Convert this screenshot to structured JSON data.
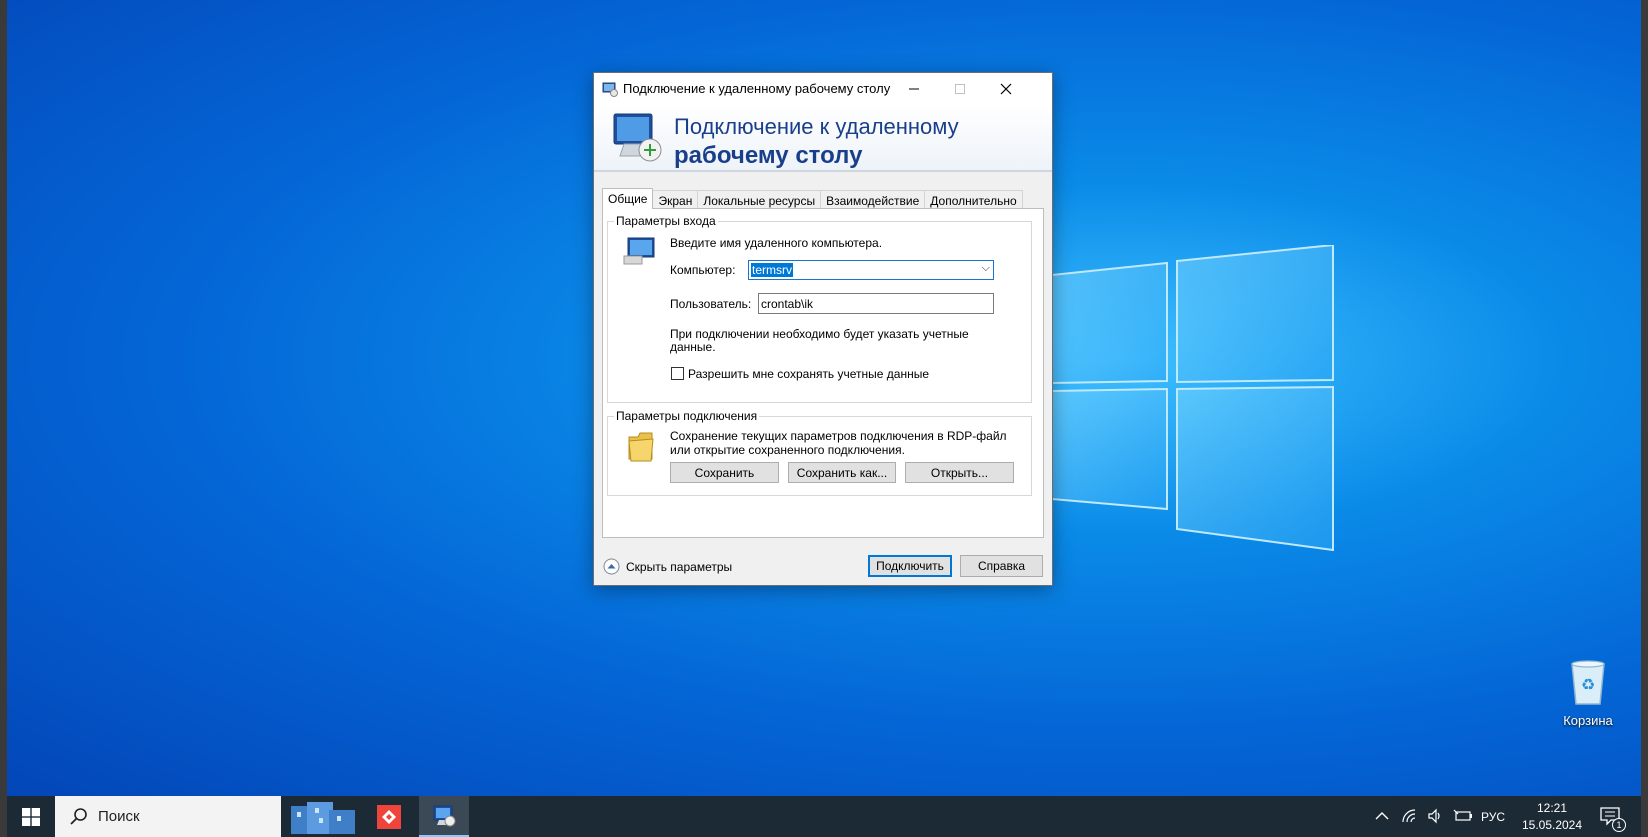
{
  "dialog": {
    "title": "Подключение к удаленному рабочему столу",
    "banner_line1": "Подключение к удаленному",
    "banner_line2": "рабочему столу",
    "tabs": [
      "Общие",
      "Экран",
      "Локальные ресурсы",
      "Взаимодействие",
      "Дополнительно"
    ],
    "logon": {
      "legend": "Параметры входа",
      "hint": "Введите имя удаленного компьютера.",
      "computer_label": "Компьютер:",
      "computer_value": "termsrv",
      "user_label": "Пользователь:",
      "user_value": "crontab\\ik",
      "credentials_note_line1": "При подключении необходимо будет указать учетные",
      "credentials_note_line2": "данные.",
      "save_credentials_label": "Разрешить мне сохранять учетные данные"
    },
    "connection": {
      "legend": "Параметры подключения",
      "desc_line1": "Сохранение текущих параметров подключения в RDP-файл",
      "desc_line2": "или открытие сохраненного подключения.",
      "save_label": "Сохранить",
      "save_as_label": "Сохранить как...",
      "open_label": "Открыть..."
    },
    "hide_options_label": "Скрыть параметры",
    "connect_label": "Подключить",
    "help_label": "Справка"
  },
  "desktop": {
    "recycle_bin_label": "Корзина"
  },
  "taskbar": {
    "search_text": "Поиск",
    "language": "РУС",
    "time": "12:21",
    "date": "15.05.2024",
    "notification_count": "1"
  },
  "colors": {
    "accent": "#0078d7",
    "banner_text": "#1a3f8a",
    "taskbar": "#1c2a36"
  }
}
